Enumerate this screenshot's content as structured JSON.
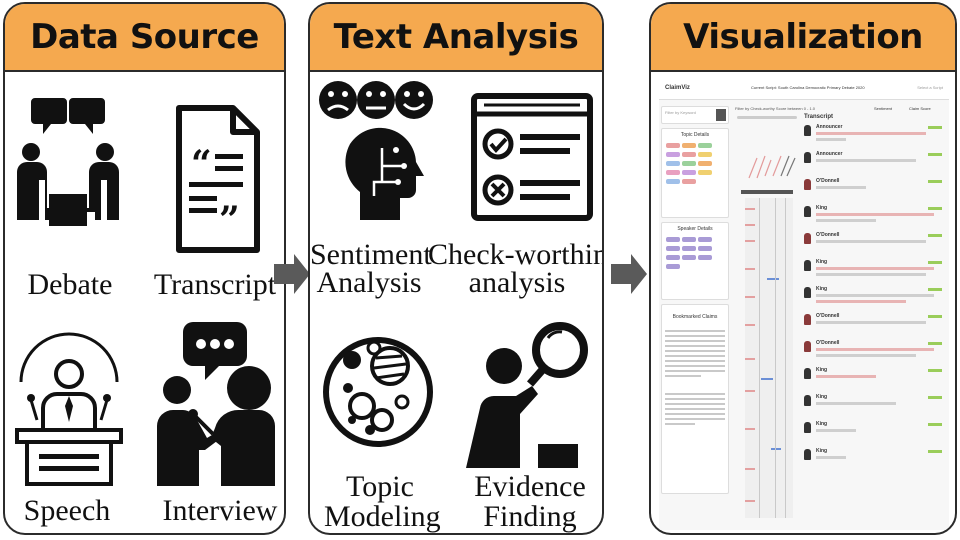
{
  "panels": {
    "data_source": {
      "title": "Data Source",
      "items": [
        "Debate",
        "Transcript",
        "Speech",
        "Interview"
      ]
    },
    "text_analysis": {
      "title": "Text Analysis",
      "items": [
        {
          "line1": "Sentiment",
          "line2": "Analysis"
        },
        {
          "line1": "Check-worthiness",
          "line2": "analysis"
        },
        {
          "line1": "Topic",
          "line2": "Modeling"
        },
        {
          "line1": "Evidence",
          "line2": "Finding"
        }
      ]
    },
    "visualization": {
      "title": "Visualization",
      "screenshot": {
        "app_name": "ClaimViz",
        "current_script": "Current Script: South Carolina Democratic Primary Debate 2020",
        "select_script": "Select a Script",
        "filter_keyword": "Filter by Keyword",
        "filter_score": "Filter by Check-worthy Score between 0 - 1.0",
        "transcript_title": "Transcript",
        "sentiment_label": "Sentiment",
        "claim_score_label": "Claim Score",
        "topic_details": "Topic Details",
        "speaker_details": "Speaker Details",
        "bookmarked_claims": "Bookmarked Claims",
        "speakers": [
          "Announcer",
          "Announcer",
          "O'Donnell",
          "King",
          "O'Donnell",
          "King",
          "King",
          "King",
          "O'Donnell",
          "O'Donnell",
          "King",
          "King",
          "King"
        ]
      }
    }
  },
  "colors": {
    "header": "#f5a94f",
    "border": "#2b2b2b",
    "arrow": "#5a5a5a"
  }
}
